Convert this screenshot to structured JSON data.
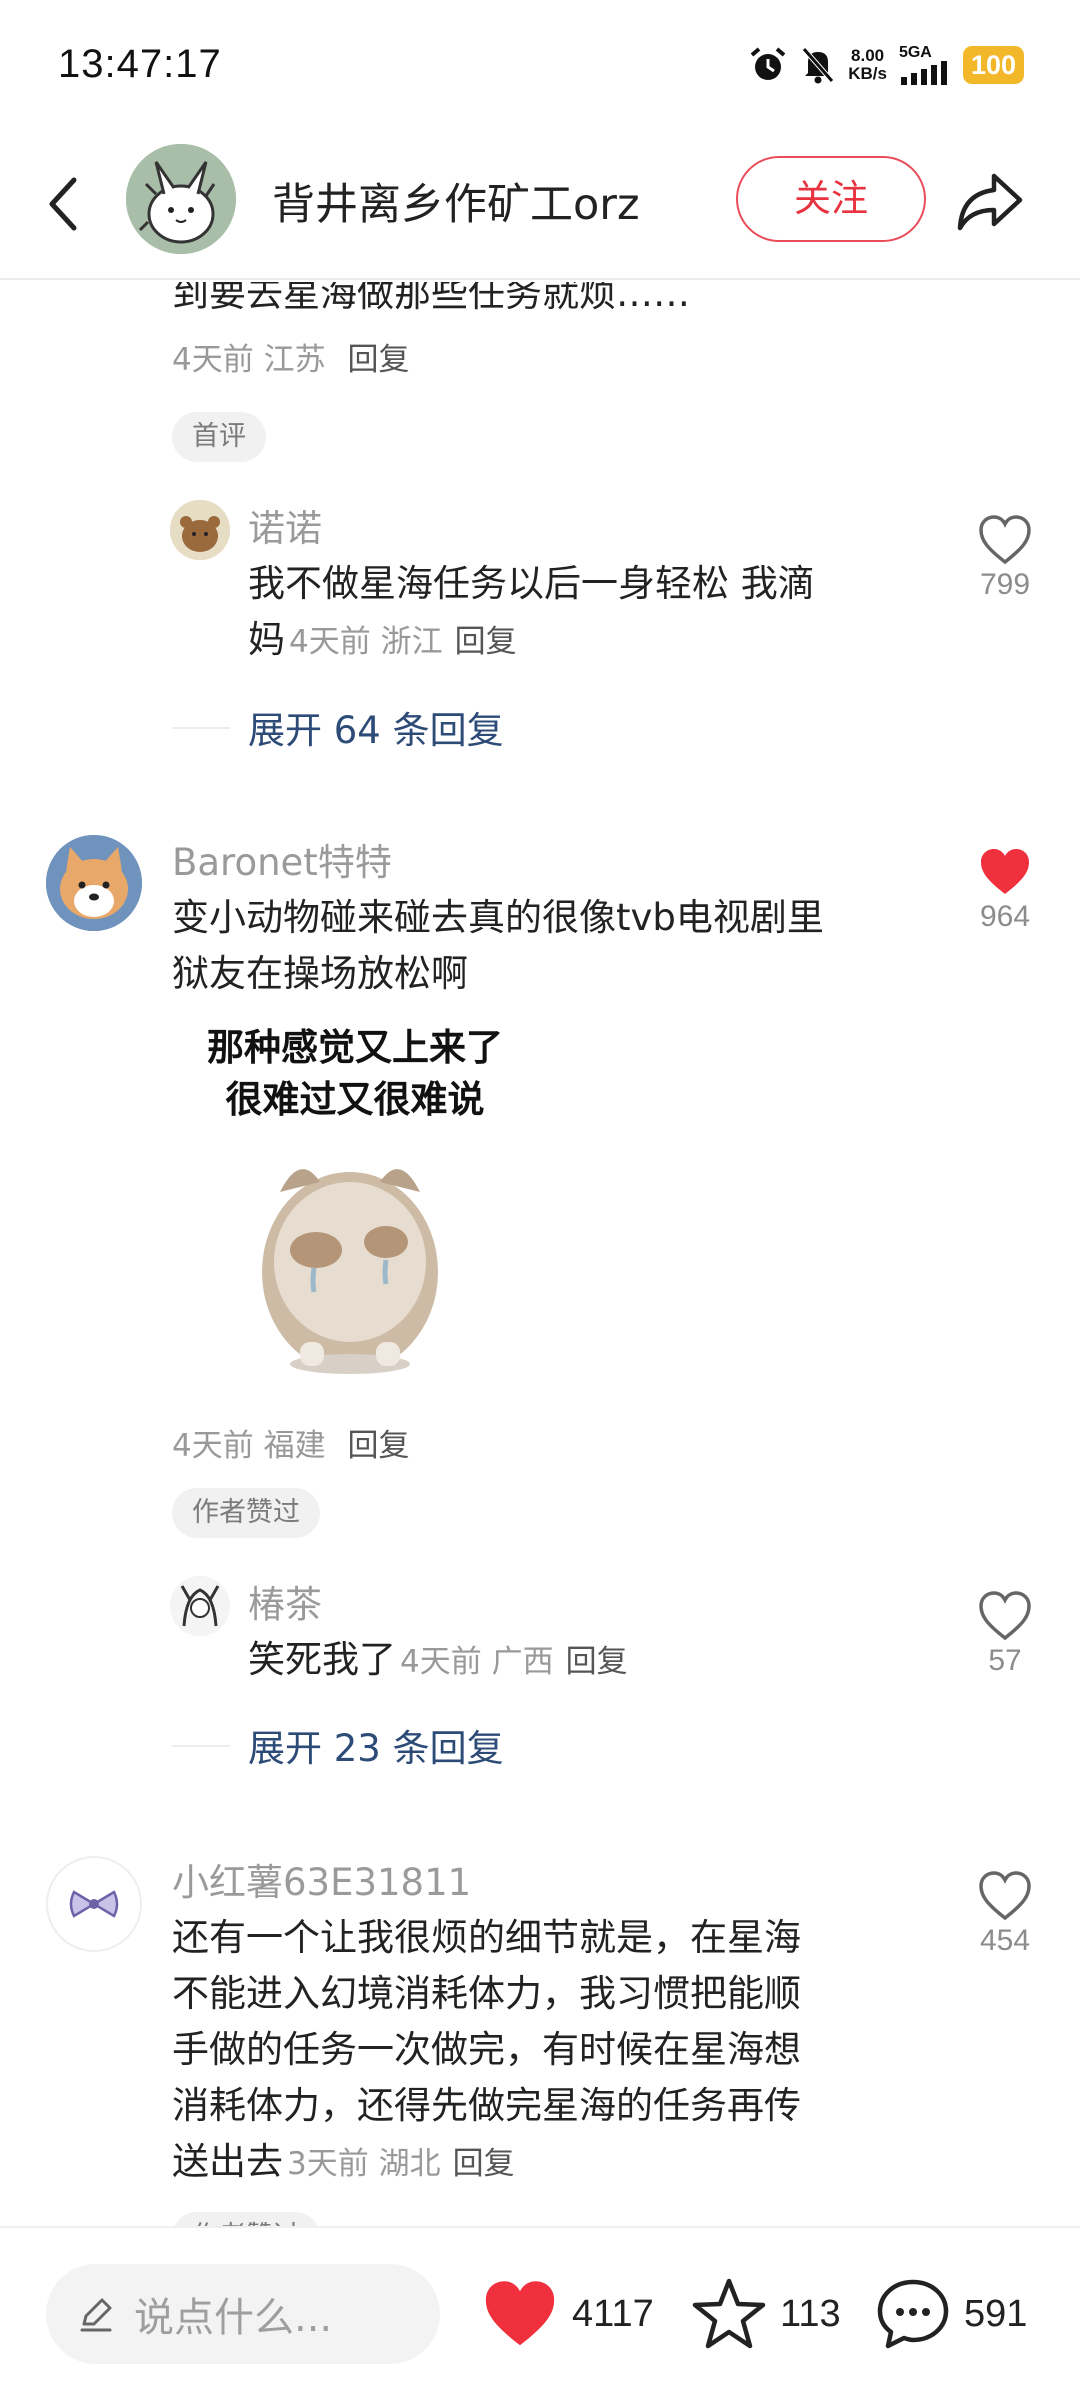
{
  "status_bar": {
    "time": "13:47:17",
    "speed_value": "8.00",
    "speed_unit": "KB/s",
    "network": "5GA",
    "battery": "100",
    "icons": [
      "alarm-icon",
      "mute-icon",
      "signal-icon"
    ]
  },
  "header": {
    "username": "背井离乡作矿工orz",
    "follow_label": "关注",
    "icons": [
      "back-arrow-icon",
      "share-icon"
    ]
  },
  "comments": {
    "c0": {
      "text_tail": "到要去星海做那些任务就烦……",
      "time": "4天前",
      "location": "江苏",
      "reply_label": "回复",
      "badge": "首评",
      "sub_reply": {
        "nickname": "诺诺",
        "line1": "我不做星海任务以后一身轻松 我滴",
        "line2": "妈",
        "time": "4天前",
        "location": "浙江",
        "reply_label": "回复",
        "likes": "799"
      },
      "expand_label": "展开 64 条回复"
    },
    "c1": {
      "nickname": "Baronet特特",
      "line1": "变小动物碰来碰去真的很像tvb电视剧里",
      "line2": "狱友在操场放松啊",
      "sticker_line1": "那种感觉又上来了",
      "sticker_line2": "很难过又很难说",
      "time": "4天前",
      "location": "福建",
      "reply_label": "回复",
      "likes": "964",
      "liked": true,
      "badge": "作者赞过",
      "sub_reply": {
        "nickname": "椿茶",
        "text": "笑死我了",
        "time": "4天前",
        "location": "广西",
        "reply_label": "回复",
        "likes": "57"
      },
      "expand_label": "展开 23 条回复"
    },
    "c2": {
      "nickname": "小红薯63E31811",
      "line1": "还有一个让我很烦的细节就是，在星海",
      "line2": "不能进入幻境消耗体力，我习惯把能顺",
      "line3": "手做的任务一次做完，有时候在星海想",
      "line4": "消耗体力，还得先做完星海的任务再传",
      "line5": "送出去",
      "time": "3天前",
      "location": "湖北",
      "reply_label": "回复",
      "likes": "454",
      "badge_partial": "作者赞过"
    }
  },
  "bottom_bar": {
    "input_placeholder": "说点什么...",
    "likes": "4117",
    "collects": "113",
    "comments": "591"
  },
  "colors": {
    "accent_red": "#f0303d",
    "link_blue": "#2d4b77",
    "battery_yellow": "#f3b82a"
  }
}
